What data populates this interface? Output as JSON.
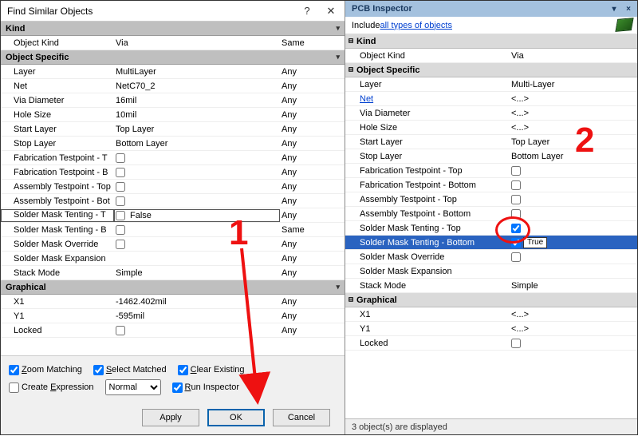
{
  "left": {
    "title": "Find Similar Objects",
    "sections": {
      "kind": {
        "header": "Kind",
        "rows": [
          {
            "label": "Object Kind",
            "value": "Via",
            "scope": "Same"
          }
        ]
      },
      "objspec": {
        "header": "Object Specific",
        "rows": [
          {
            "label": "Layer",
            "value": "MultiLayer",
            "scope": "Any"
          },
          {
            "label": "Net",
            "value": "NetC70_2",
            "scope": "Any"
          },
          {
            "label": "Via Diameter",
            "value": "16mil",
            "scope": "Any"
          },
          {
            "label": "Hole Size",
            "value": "10mil",
            "scope": "Any"
          },
          {
            "label": "Start Layer",
            "value": "Top Layer",
            "scope": "Any"
          },
          {
            "label": "Stop Layer",
            "value": "Bottom Layer",
            "scope": "Any"
          },
          {
            "label": "Fabrication Testpoint - T",
            "check": false,
            "scope": "Any"
          },
          {
            "label": "Fabrication Testpoint - B",
            "check": false,
            "scope": "Any"
          },
          {
            "label": "Assembly Testpoint - Top",
            "check": false,
            "scope": "Any"
          },
          {
            "label": "Assembly Testpoint - Bot",
            "check": false,
            "scope": "Any"
          },
          {
            "label": "Solder Mask Tenting - T",
            "check": false,
            "valtext": "False",
            "scope": "Any",
            "selected": true
          },
          {
            "label": "Solder Mask Tenting - B",
            "check": false,
            "scope": "Same"
          },
          {
            "label": "Solder Mask Override",
            "check": false,
            "scope": "Any"
          },
          {
            "label": "Solder Mask Expansion",
            "value": "",
            "scope": "Any"
          },
          {
            "label": "Stack Mode",
            "value": "Simple",
            "scope": "Any"
          }
        ]
      },
      "graph": {
        "header": "Graphical",
        "rows": [
          {
            "label": "X1",
            "value": "-1462.402mil",
            "scope": "Any"
          },
          {
            "label": "Y1",
            "value": "-595mil",
            "scope": "Any"
          },
          {
            "label": "Locked",
            "check": false,
            "scope": "Any"
          }
        ]
      }
    },
    "opts": {
      "zoom": "Zoom Matching",
      "select": "Select Matched",
      "clear": "Clear Existing",
      "create": "Create Expression",
      "mask": "Normal",
      "run": "Run Inspector",
      "zoom_chk": true,
      "select_chk": true,
      "clear_chk": true,
      "create_chk": false,
      "run_chk": true
    },
    "buttons": {
      "apply": "Apply",
      "ok": "OK",
      "cancel": "Cancel"
    }
  },
  "right": {
    "title": "PCB Inspector",
    "include_prefix": "Include ",
    "include_link": "all types of objects",
    "sections": {
      "kind": {
        "header": "Kind",
        "rows": [
          {
            "label": "Object Kind",
            "value": "Via"
          }
        ]
      },
      "objspec": {
        "header": "Object Specific",
        "rows": [
          {
            "label": "Layer",
            "value": "Multi-Layer"
          },
          {
            "label": "Net",
            "value": "<...>",
            "link": true
          },
          {
            "label": "Via Diameter",
            "value": "<...>"
          },
          {
            "label": "Hole Size",
            "value": "<...>"
          },
          {
            "label": "Start Layer",
            "value": "Top Layer"
          },
          {
            "label": "Stop Layer",
            "value": "Bottom Layer"
          },
          {
            "label": "Fabrication Testpoint - Top",
            "check": false
          },
          {
            "label": "Fabrication Testpoint - Bottom",
            "check": false
          },
          {
            "label": "Assembly Testpoint - Top",
            "check": false
          },
          {
            "label": "Assembly Testpoint - Bottom",
            "check": false
          },
          {
            "label": "Solder Mask Tenting - Top",
            "check": true
          },
          {
            "label": "Solder Mask Tenting - Bottom",
            "check": true,
            "edit": "True",
            "hl": true
          },
          {
            "label": "Solder Mask Override",
            "check": false
          },
          {
            "label": "Solder Mask Expansion",
            "value": ""
          },
          {
            "label": "Stack Mode",
            "value": "Simple"
          }
        ]
      },
      "graph": {
        "header": "Graphical",
        "rows": [
          {
            "label": "X1",
            "value": "<...>"
          },
          {
            "label": "Y1",
            "value": "<...>"
          },
          {
            "label": "Locked",
            "check": false
          }
        ]
      }
    },
    "status": "3 object(s) are displayed"
  },
  "anno": {
    "one": "1",
    "two": "2"
  }
}
